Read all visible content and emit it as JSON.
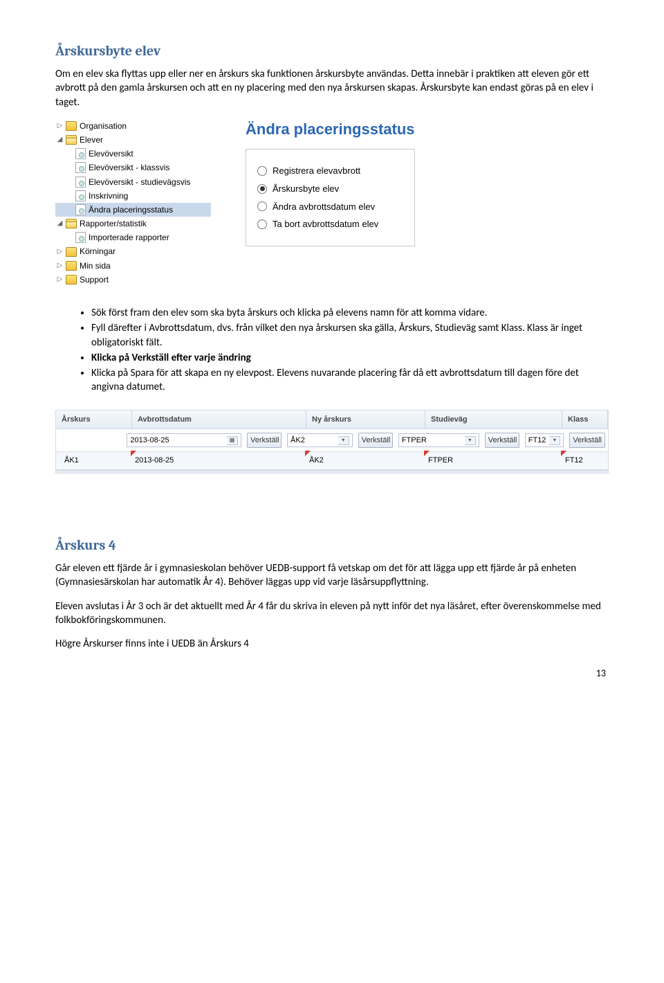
{
  "section1": {
    "title": "Årskursbyte elev",
    "para": "Om en elev ska flyttas upp eller ner en årskurs ska funktionen årskursbyte användas. Detta innebär i praktiken att eleven gör ett avbrott på den gamla årskursen och att en ny placering med den nya årskursen skapas. Årskursbyte kan endast göras på en elev i taget."
  },
  "nav": {
    "items": [
      {
        "lvl": 0,
        "tri": "▷",
        "ico": "folder",
        "label": "Organisation"
      },
      {
        "lvl": 0,
        "tri": "◢",
        "ico": "folder-open",
        "label": "Elever"
      },
      {
        "lvl": 1,
        "tri": "",
        "ico": "page",
        "label": "Elevöversikt"
      },
      {
        "lvl": 1,
        "tri": "",
        "ico": "page",
        "label": "Elevöversikt - klassvis"
      },
      {
        "lvl": 1,
        "tri": "",
        "ico": "page",
        "label": "Elevöversikt - studievägsvis"
      },
      {
        "lvl": 1,
        "tri": "",
        "ico": "page",
        "label": "Inskrivning"
      },
      {
        "lvl": 1,
        "tri": "",
        "ico": "page",
        "label": "Ändra placeringsstatus",
        "selected": true
      },
      {
        "lvl": 0,
        "tri": "◢",
        "ico": "folder-open",
        "label": "Rapporter/statistik"
      },
      {
        "lvl": 1,
        "tri": "",
        "ico": "page",
        "label": "Importerade rapporter"
      },
      {
        "lvl": 0,
        "tri": "▷",
        "ico": "folder",
        "label": "Körningar"
      },
      {
        "lvl": 0,
        "tri": "▷",
        "ico": "folder",
        "label": "Min sida"
      },
      {
        "lvl": 0,
        "tri": "▷",
        "ico": "folder",
        "label": "Support"
      }
    ]
  },
  "form": {
    "title": "Ändra placeringsstatus",
    "radios": [
      {
        "label": "Registrera elevavbrott",
        "checked": false
      },
      {
        "label": "Årskursbyte elev",
        "checked": true
      },
      {
        "label": "Ändra avbrottsdatum elev",
        "checked": false
      },
      {
        "label": "Ta bort avbrottsdatum elev",
        "checked": false
      }
    ]
  },
  "bullets": [
    "Sök först fram den elev som ska byta årskurs och klicka på elevens namn för att komma vidare.",
    "Fyll därefter i Avbrottsdatum, dvs. från vilket den nya årskursen ska gälla, Årskurs, Studieväg samt Klass. Klass är inget obligatoriskt fält.",
    "Klicka på Verkställ efter varje ändring",
    "Klicka på Spara för att skapa en ny elevpost. Elevens nuvarande placering får då ett avbrottsdatum till dagen före det angivna datumet."
  ],
  "table": {
    "headers": {
      "arsk": "Årskurs",
      "avb": "Avbrottsdatum",
      "ny": "Ny årskurs",
      "stud": "Studieväg",
      "klass": "Klass"
    },
    "verk": "Verkställ",
    "row_edit": {
      "avb": "2013-08-25",
      "ny": "ÅK2",
      "stud": "FTPER",
      "klass": "FT12"
    },
    "row_ro": {
      "arsk": "ÅK1",
      "avb": "2013-08-25",
      "ny": "ÅK2",
      "stud": "FTPER",
      "klass": "FT12"
    }
  },
  "section2": {
    "title": "Årskurs 4",
    "p1": "Går eleven ett fjärde år i gymnasieskolan behöver UEDB-support få vetskap om det för att lägga upp ett fjärde år på enheten (Gymnasiesärskolan har automatik År 4). Behöver läggas upp vid varje läsårsuppflyttning.",
    "p2": "Eleven avslutas i År 3 och är det aktuellt med År 4 får du skriva in eleven på nytt inför det nya läsåret, efter överenskommelse med folkbokföringskommunen.",
    "p3": "Högre Årskurser finns inte i UEDB än Årskurs 4"
  },
  "page_num": "13"
}
